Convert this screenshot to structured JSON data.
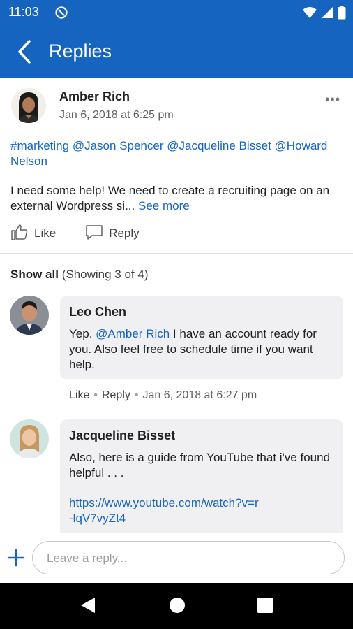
{
  "status_bar": {
    "time": "11:03"
  },
  "app_bar": {
    "title": "Replies"
  },
  "post": {
    "author": "Amber Rich",
    "date": "Jan 6, 2018 at 6:25 pm",
    "tags": [
      "#marketing",
      "@Jason Spencer",
      "@Jacqueline Bisset",
      "@Howard Nelson"
    ],
    "body": "I need some help! We need to create a recruiting page on an external Wordpress si...",
    "see_more": "See more",
    "like_label": "Like",
    "reply_label": "Reply"
  },
  "replies_header": {
    "show_all": "Show all",
    "count_text": "(Showing 3 of 4)"
  },
  "replies": [
    {
      "author": "Leo Chen",
      "mention": "@Amber Rich",
      "text_before": "Yep. ",
      "text_after": " I have an account ready for you.  Also feel free to schedule time if you want help.",
      "like_label": "Like",
      "reply_label": "Reply",
      "date": "Jan 6, 2018 at 6:27 pm"
    },
    {
      "author": "Jacqueline Bisset",
      "text": "Also, here is a guide from YouTube that i've found helpful . . .",
      "link_line1": "https://www.youtube.com/watch?v=r",
      "link_line2": "-lqV7vyZt4"
    }
  ],
  "composer": {
    "placeholder": "Leave a reply..."
  },
  "colors": {
    "brand_blue": "#1565c0",
    "bubble_bg": "#f0f0f3"
  }
}
